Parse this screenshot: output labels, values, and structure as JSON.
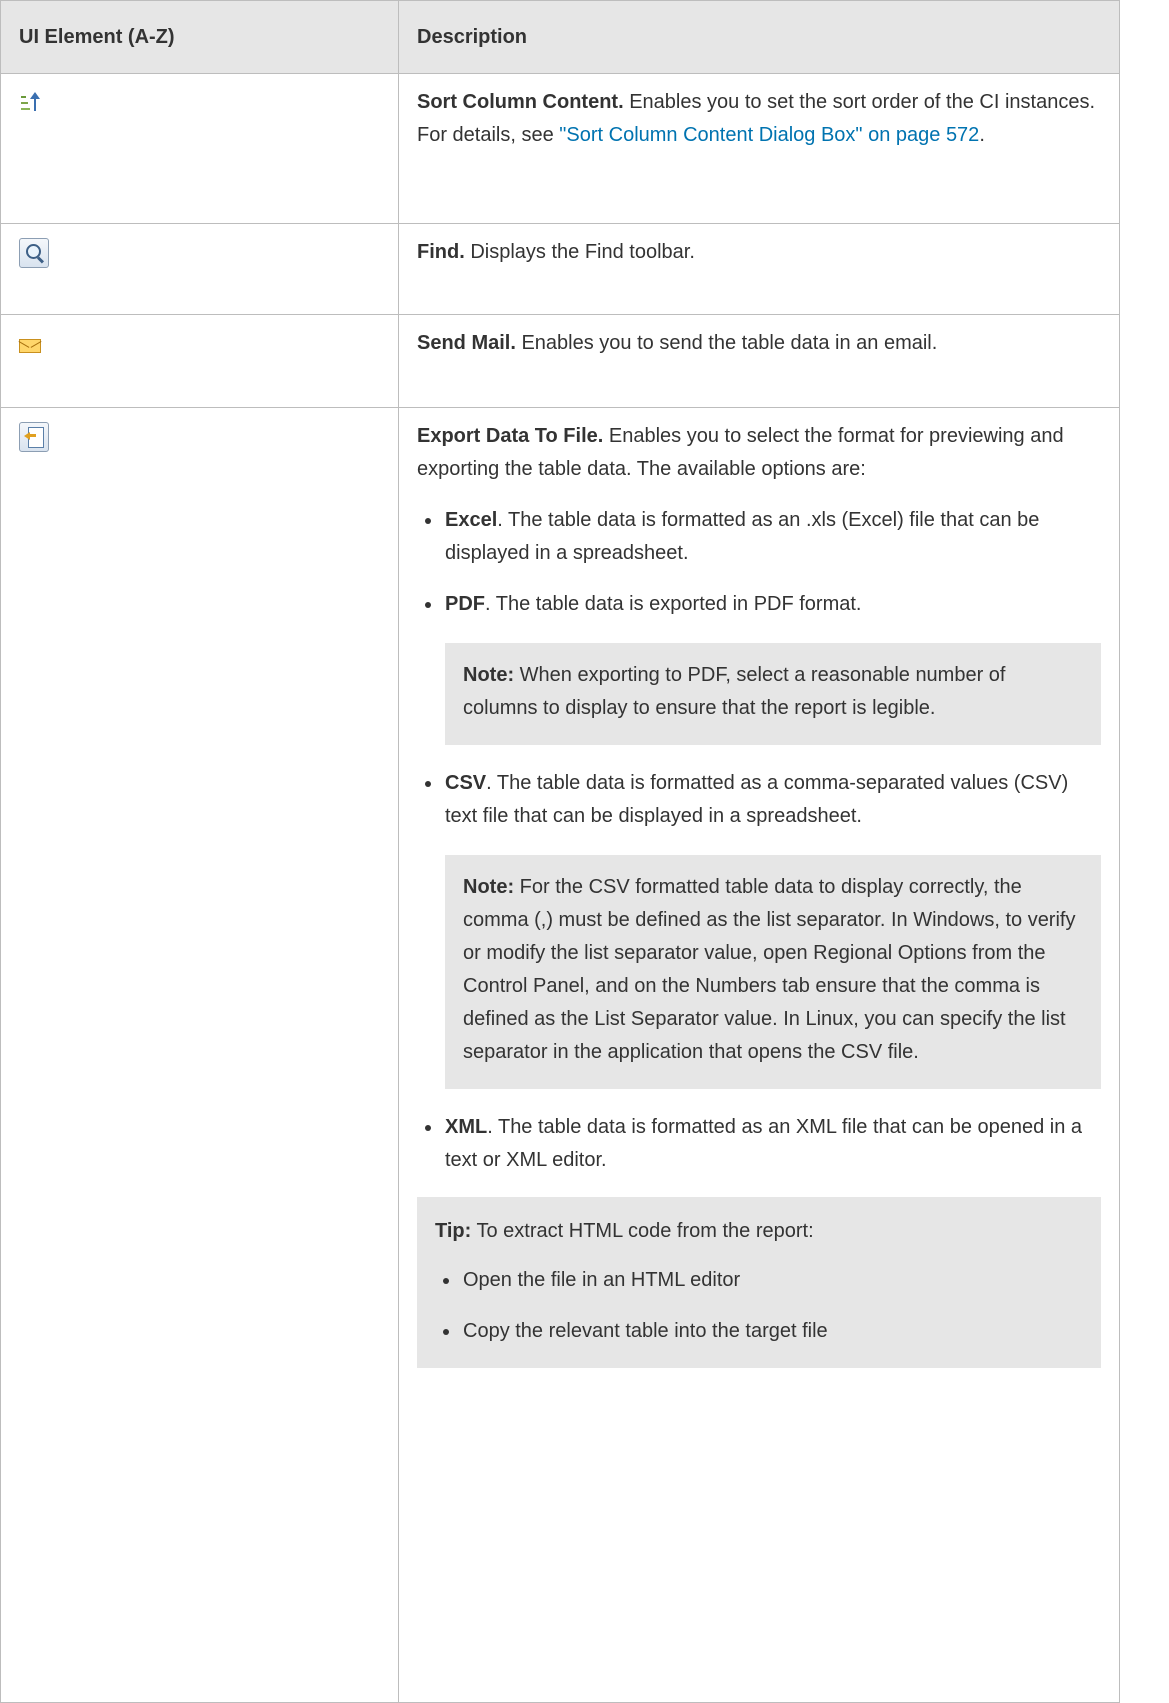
{
  "table": {
    "header": {
      "col1": "UI Element (A-Z)",
      "col2": "Description"
    },
    "rows": {
      "sort": {
        "icon": "sort-ascending-icon",
        "title": "Sort Column Content.",
        "text": " Enables you to set the sort order of the CI instances. For details, see ",
        "link": "\"Sort Column Content Dialog Box\" on page 572",
        "end": "."
      },
      "find": {
        "icon": "find-magnifier-icon",
        "title": "Find.",
        "text": " Displays the Find toolbar."
      },
      "mail": {
        "icon": "envelope-mail-icon",
        "title": "Send Mail.",
        "text": " Enables you to send the table data in an email."
      },
      "export": {
        "icon": "export-to-file-icon",
        "title": "Export Data To File.",
        "text": " Enables you to select the format for previewing and exporting the table data. The available options are:",
        "excel_label": "Excel",
        "excel_text": ". The table data is formatted as an .xls (Excel) file that can be displayed in a spreadsheet.",
        "pdf_label": "PDF",
        "pdf_text": ". The table data is exported in PDF format.",
        "pdf_note_label": "Note:",
        "pdf_note_text": " When exporting to PDF, select a reasonable number of columns to display to ensure that the report is legible.",
        "csv_label": "CSV",
        "csv_text": ". The table data is formatted as a comma-separated values (CSV) text file that can be displayed in a spreadsheet.",
        "csv_note_label": "Note:",
        "csv_note_text": " For the CSV formatted table data to display correctly, the comma (,) must be defined as the list separator. In Windows, to verify or modify the list separator value, open Regional Options from the Control Panel, and on the Numbers tab ensure that the comma is defined as the List Separator value. In Linux, you can specify the list separator in the application that opens the CSV file.",
        "xml_label": "XML",
        "xml_text": ". The table data is formatted as an XML file that can be opened in a text or XML editor.",
        "tip_label": "Tip:",
        "tip_text": " To extract HTML code from the report:",
        "tip_items": [
          "Open the file in an HTML editor",
          "Copy the relevant table into the target file"
        ]
      }
    }
  }
}
